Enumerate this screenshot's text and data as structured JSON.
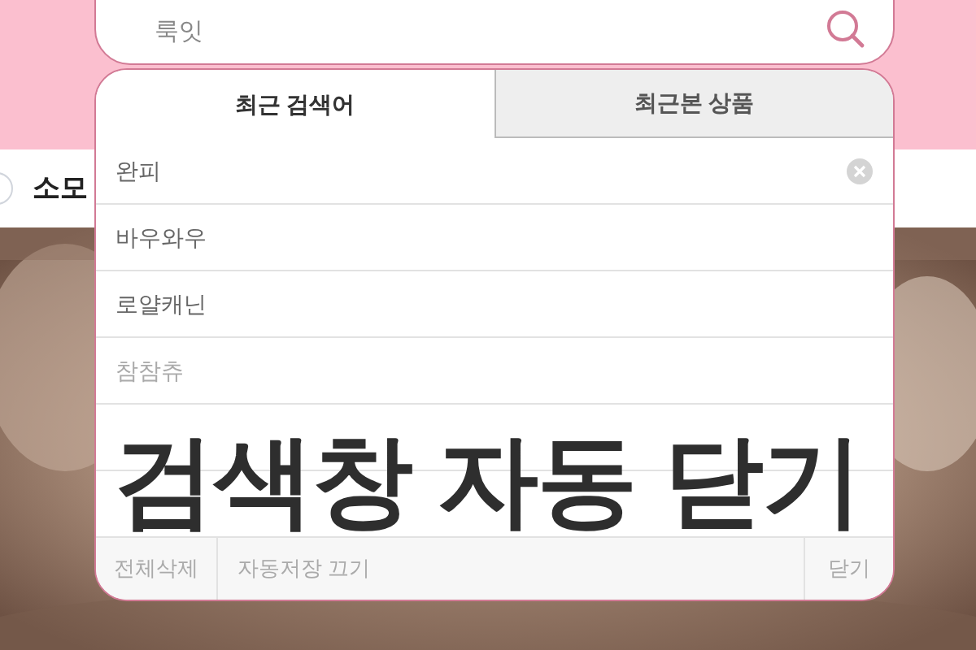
{
  "search": {
    "value": "룩잇"
  },
  "tabs": [
    {
      "label": "최근 검색어",
      "selected": true
    },
    {
      "label": "최근본 상품",
      "selected": false
    }
  ],
  "recent_searches": [
    {
      "text": "완피",
      "removable": true
    },
    {
      "text": "바우와우",
      "removable": false
    },
    {
      "text": "로얄캐닌",
      "removable": false
    },
    {
      "text": "참참츄",
      "removable": false
    }
  ],
  "footer": {
    "delete_all": "전체삭제",
    "autosave": "자동저장 끄기",
    "close": "닫기"
  },
  "background_label": "소모",
  "caption": "검색창 자동 닫기"
}
